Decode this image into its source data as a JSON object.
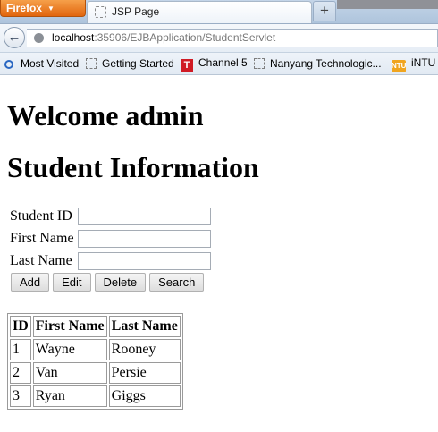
{
  "browser": {
    "menu_label": "Firefox",
    "tab_title": "JSP Page",
    "new_tab_label": "+",
    "url_host": "localhost",
    "url_rest": ":35906/EJBApplication/StudentServlet"
  },
  "bookmarks": [
    {
      "label": "Most Visited",
      "icon": "search-icon"
    },
    {
      "label": "Getting Started",
      "icon": "page-icon"
    },
    {
      "label": "Channel 5",
      "icon": "t-logo-icon"
    },
    {
      "label": "Nanyang Technologic...",
      "icon": "page-icon"
    },
    {
      "label": "iNTU",
      "icon": "ntu-icon"
    }
  ],
  "page": {
    "welcome": "Welcome admin",
    "heading": "Student Information",
    "form": {
      "id_label": "Student ID",
      "first_label": "First Name",
      "last_label": "Last Name",
      "id_value": "",
      "first_value": "",
      "last_value": ""
    },
    "buttons": {
      "add": "Add",
      "edit": "Edit",
      "delete": "Delete",
      "search": "Search"
    },
    "table": {
      "headers": [
        "ID",
        "First Name",
        "Last Name"
      ],
      "rows": [
        [
          "1",
          "Wayne",
          "Rooney"
        ],
        [
          "2",
          "Van",
          "Persie"
        ],
        [
          "3",
          "Ryan",
          "Giggs"
        ]
      ]
    }
  },
  "colors": {
    "firefox_button": "#e1650d",
    "channel5_logo": "#d01b25",
    "ntu_logo": "#f0a51f"
  }
}
